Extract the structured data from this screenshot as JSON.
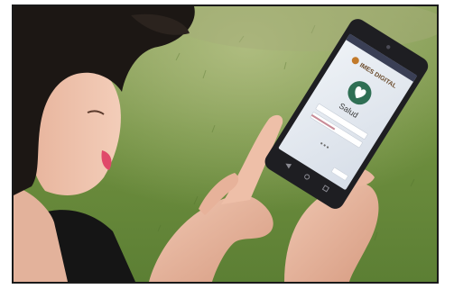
{
  "photo": {
    "app_brand": "IMES DIGITAL",
    "app_section": "Salud",
    "app_icon": "heart-icon"
  }
}
